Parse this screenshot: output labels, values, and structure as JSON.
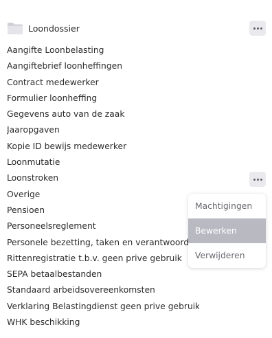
{
  "folder": {
    "title": "Loondossier",
    "icon": "folder-icon",
    "icon_color": "#cfcfd6",
    "more_icon": "more-horizontal-icon"
  },
  "files": [
    "Aangifte Loonbelasting",
    "Aangiftebrief loonheffingen",
    "Contract medewerker",
    "Formulier loonheffing",
    "Gegevens auto van de zaak",
    "Jaaropgaven",
    "Kopie ID bewijs medewerker",
    "Loonmutatie",
    "Loonstroken",
    "Overige",
    "Pensioen",
    "Personeelsreglement",
    "Personele bezetting, taken en verantwoord.h.",
    "Rittenregistratie t.b.v. geen prive gebruik",
    "SEPA betaalbestanden",
    "Standaard arbeidsovereenkomsten",
    "Verklaring Belastingdienst geen prive gebruik",
    "WHK beschikking"
  ],
  "context_menu": {
    "items": [
      {
        "label": "Machtigingen",
        "active": false
      },
      {
        "label": "Bewerken",
        "active": true
      },
      {
        "label": "Verwijderen",
        "active": false
      }
    ],
    "highlight_color": "#b9b9c2"
  }
}
